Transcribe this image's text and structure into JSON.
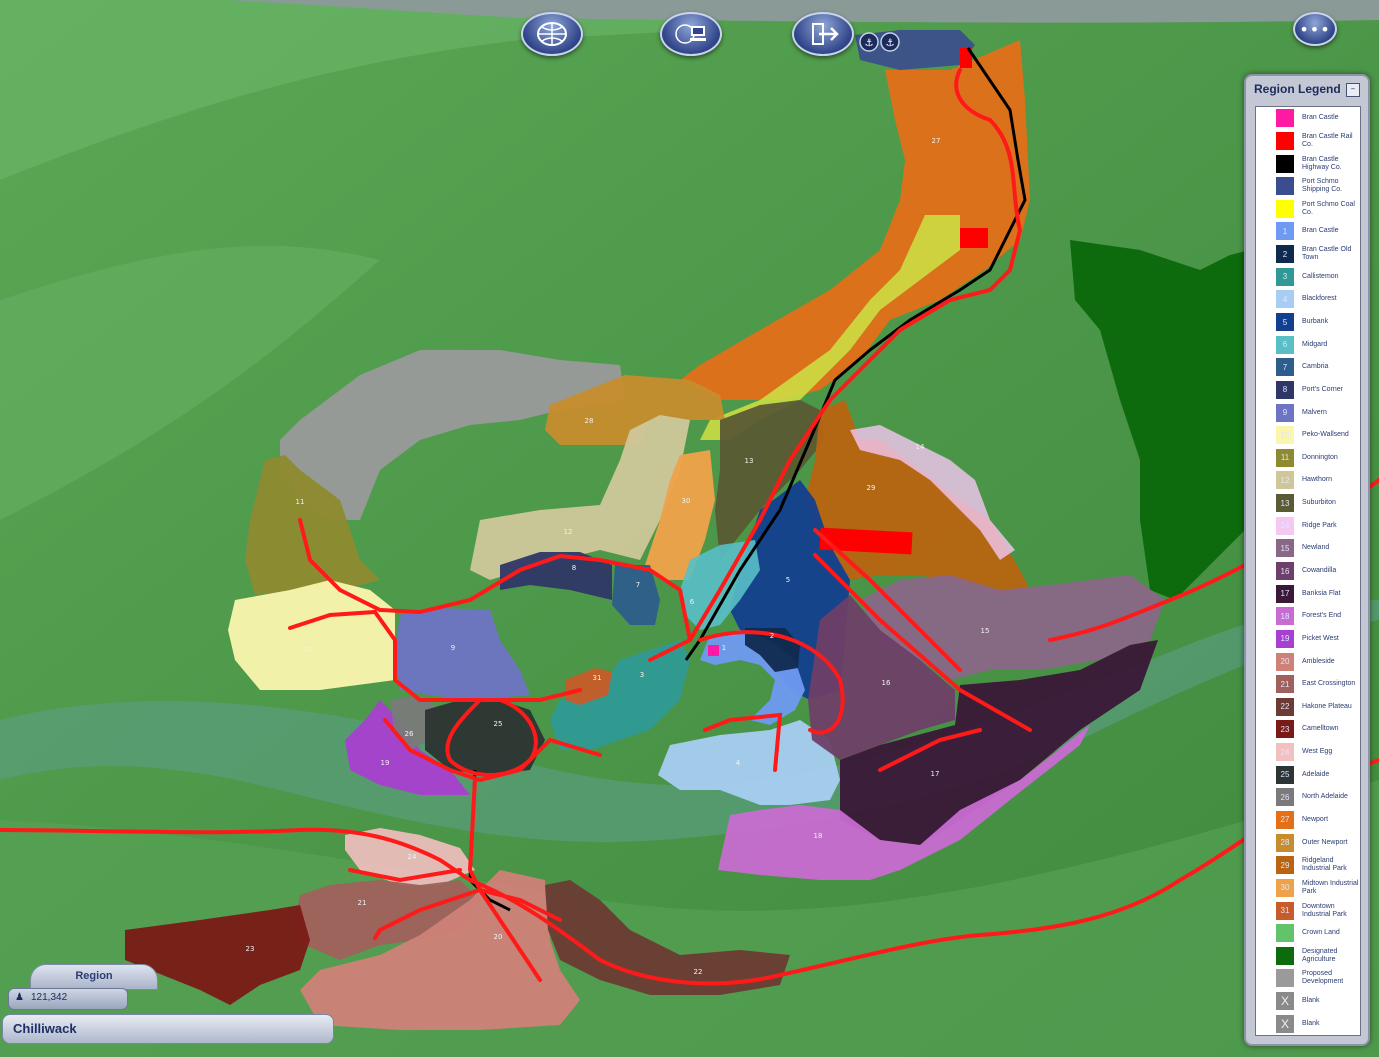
{
  "toolbar": {
    "region_view_icon": "region-globe-icon",
    "network_icon": "network-computer-icon",
    "exit_icon": "exit-arrow-icon",
    "more_label": "•••"
  },
  "legend": {
    "title": "Region Legend",
    "minimize_label": "–",
    "items": [
      {
        "num": "",
        "label": "Bran Castle",
        "color": "#ff1aa3"
      },
      {
        "num": "",
        "label": "Bran Castle Rail Co.",
        "color": "#ff0000"
      },
      {
        "num": "",
        "label": "Bran Castle Highway Co.",
        "color": "#000000"
      },
      {
        "num": "",
        "label": "Port Schmo Shipping Co.",
        "color": "#3a4d8f",
        "icon": "anchor-icon"
      },
      {
        "num": "",
        "label": "Port Schmo Coal Co.",
        "color": "#ffff00"
      },
      {
        "num": "1",
        "label": "Bran Castle",
        "color": "#6f9af1"
      },
      {
        "num": "2",
        "label": "Bran Castle Old Town",
        "color": "#102a4f"
      },
      {
        "num": "3",
        "label": "Callistemon",
        "color": "#2f9a95"
      },
      {
        "num": "4",
        "label": "Blackforest",
        "color": "#a8cdf2"
      },
      {
        "num": "5",
        "label": "Burbank",
        "color": "#133f8f"
      },
      {
        "num": "6",
        "label": "Midgard",
        "color": "#58bfc7"
      },
      {
        "num": "7",
        "label": "Cambria",
        "color": "#2c5d8c"
      },
      {
        "num": "8",
        "label": "Port's Corner",
        "color": "#2e3766"
      },
      {
        "num": "9",
        "label": "Malvern",
        "color": "#6e74c4"
      },
      {
        "num": "10",
        "label": "Peko-Wallsend",
        "color": "#faf6ae"
      },
      {
        "num": "11",
        "label": "Donnington",
        "color": "#8e8a2f"
      },
      {
        "num": "12",
        "label": "Hawthorn",
        "color": "#cfc79a"
      },
      {
        "num": "13",
        "label": "Suburbiton",
        "color": "#5a5a34"
      },
      {
        "num": "14",
        "label": "Ridge Park",
        "color": "#f4c8f2"
      },
      {
        "num": "15",
        "label": "Newland",
        "color": "#8a6787"
      },
      {
        "num": "16",
        "label": "Cowandilla",
        "color": "#6e3f68"
      },
      {
        "num": "17",
        "label": "Banksia Flat",
        "color": "#3a1838"
      },
      {
        "num": "18",
        "label": "Forest's End",
        "color": "#c86cd1"
      },
      {
        "num": "19",
        "label": "Picket West",
        "color": "#a93fd0"
      },
      {
        "num": "20",
        "label": "Ambleside",
        "color": "#cf8178"
      },
      {
        "num": "21",
        "label": "East Crossington",
        "color": "#a0615c"
      },
      {
        "num": "22",
        "label": "Hakone Plateau",
        "color": "#6b3b34"
      },
      {
        "num": "23",
        "label": "Camelltown",
        "color": "#7a1a16"
      },
      {
        "num": "24",
        "label": "West Egg",
        "color": "#f3c0c0"
      },
      {
        "num": "25",
        "label": "Adelaide",
        "color": "#2c3434"
      },
      {
        "num": "26",
        "label": "North Adelaide",
        "color": "#7a7a7a"
      },
      {
        "num": "27",
        "label": "Newport",
        "color": "#e36f17"
      },
      {
        "num": "28",
        "label": "Outer Newport",
        "color": "#c78d2d"
      },
      {
        "num": "29",
        "label": "Ridgeland Industrial Park",
        "color": "#b86411"
      },
      {
        "num": "30",
        "label": "Midtown Industrial Park",
        "color": "#f0a24a"
      },
      {
        "num": "31",
        "label": "Downtown Industrial Park",
        "color": "#c75c2a"
      },
      {
        "num": "",
        "label": "Crown Land",
        "color": "#63c36b"
      },
      {
        "num": "",
        "label": "Designated Agriculture",
        "color": "#0d6b0d"
      },
      {
        "num": "",
        "label": "Proposed Development",
        "color": "#9a9a9a"
      },
      {
        "num": "X",
        "label": "Blank",
        "color": "#8a8a8a"
      },
      {
        "num": "X",
        "label": "Blank",
        "color": "#8a8a8a"
      }
    ]
  },
  "region": {
    "tab_label": "Region",
    "population": "121,342",
    "population_icon": "population-person-icon",
    "name": "Chilliwack"
  },
  "map": {
    "base_color": "#4f9a4c",
    "road_color": "#ff1a1a",
    "highway_color": "#000000",
    "city_labels": [
      "1",
      "2",
      "3",
      "4",
      "5",
      "6",
      "7",
      "8",
      "9",
      "10",
      "11",
      "12",
      "13",
      "14",
      "15",
      "16",
      "17",
      "18",
      "19",
      "20",
      "21",
      "22",
      "23",
      "24",
      "25",
      "26",
      "27",
      "28",
      "29",
      "30",
      "31"
    ]
  }
}
